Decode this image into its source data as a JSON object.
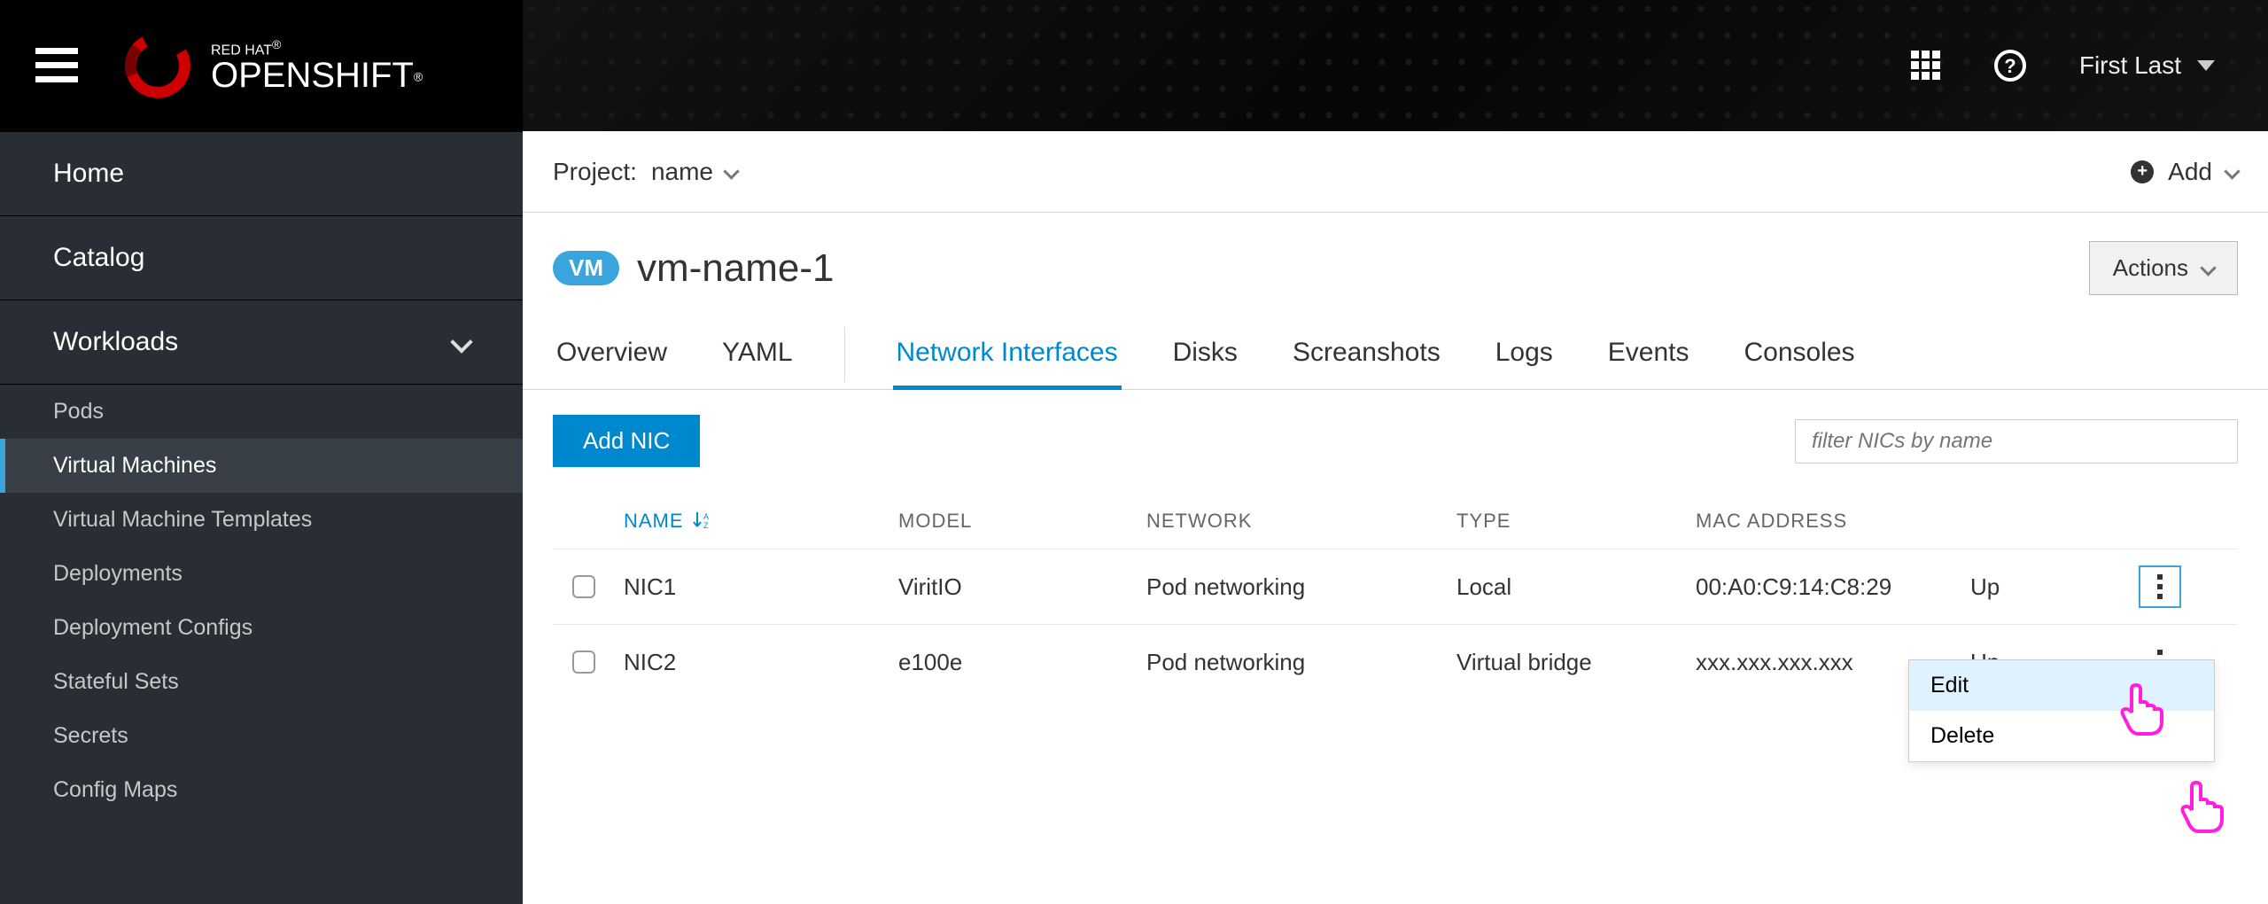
{
  "brand": {
    "line1": "RED HAT",
    "line2": "OPENSHIFT"
  },
  "user": {
    "name": "First Last"
  },
  "sidebar": {
    "home": "Home",
    "catalog": "Catalog",
    "workloads": "Workloads",
    "subs": [
      "Pods",
      "Virtual Machines",
      "Virtual Machine Templates",
      "Deployments",
      "Deployment Configs",
      "Stateful Sets",
      "Secrets",
      "Config Maps"
    ]
  },
  "project": {
    "label": "Project:",
    "name": "name"
  },
  "add_label": "Add",
  "vm": {
    "badge": "VM",
    "name": "vm-name-1"
  },
  "actions_label": "Actions",
  "tabs": [
    "Overview",
    "YAML",
    "Network Interfaces",
    "Disks",
    "Screanshots",
    "Logs",
    "Events",
    "Consoles"
  ],
  "active_tab_index": 2,
  "add_nic_label": "Add NIC",
  "filter_placeholder": "filter NICs by name",
  "columns": [
    "NAME",
    "MODEL",
    "NETWORK",
    "TYPE",
    "MAC ADDRESS",
    ""
  ],
  "status_header": "",
  "rows": [
    {
      "name": "NIC1",
      "model": "ViritIO",
      "network": "Pod networking",
      "type": "Local",
      "mac": "00:A0:C9:14:C8:29",
      "status": "Up"
    },
    {
      "name": "NIC2",
      "model": "e100e",
      "network": "Pod networking",
      "type": "Virtual bridge",
      "mac": "xxx.xxx.xxx.xxx",
      "status": "Up"
    }
  ],
  "popup": {
    "edit": "Edit",
    "delete": "Delete"
  }
}
